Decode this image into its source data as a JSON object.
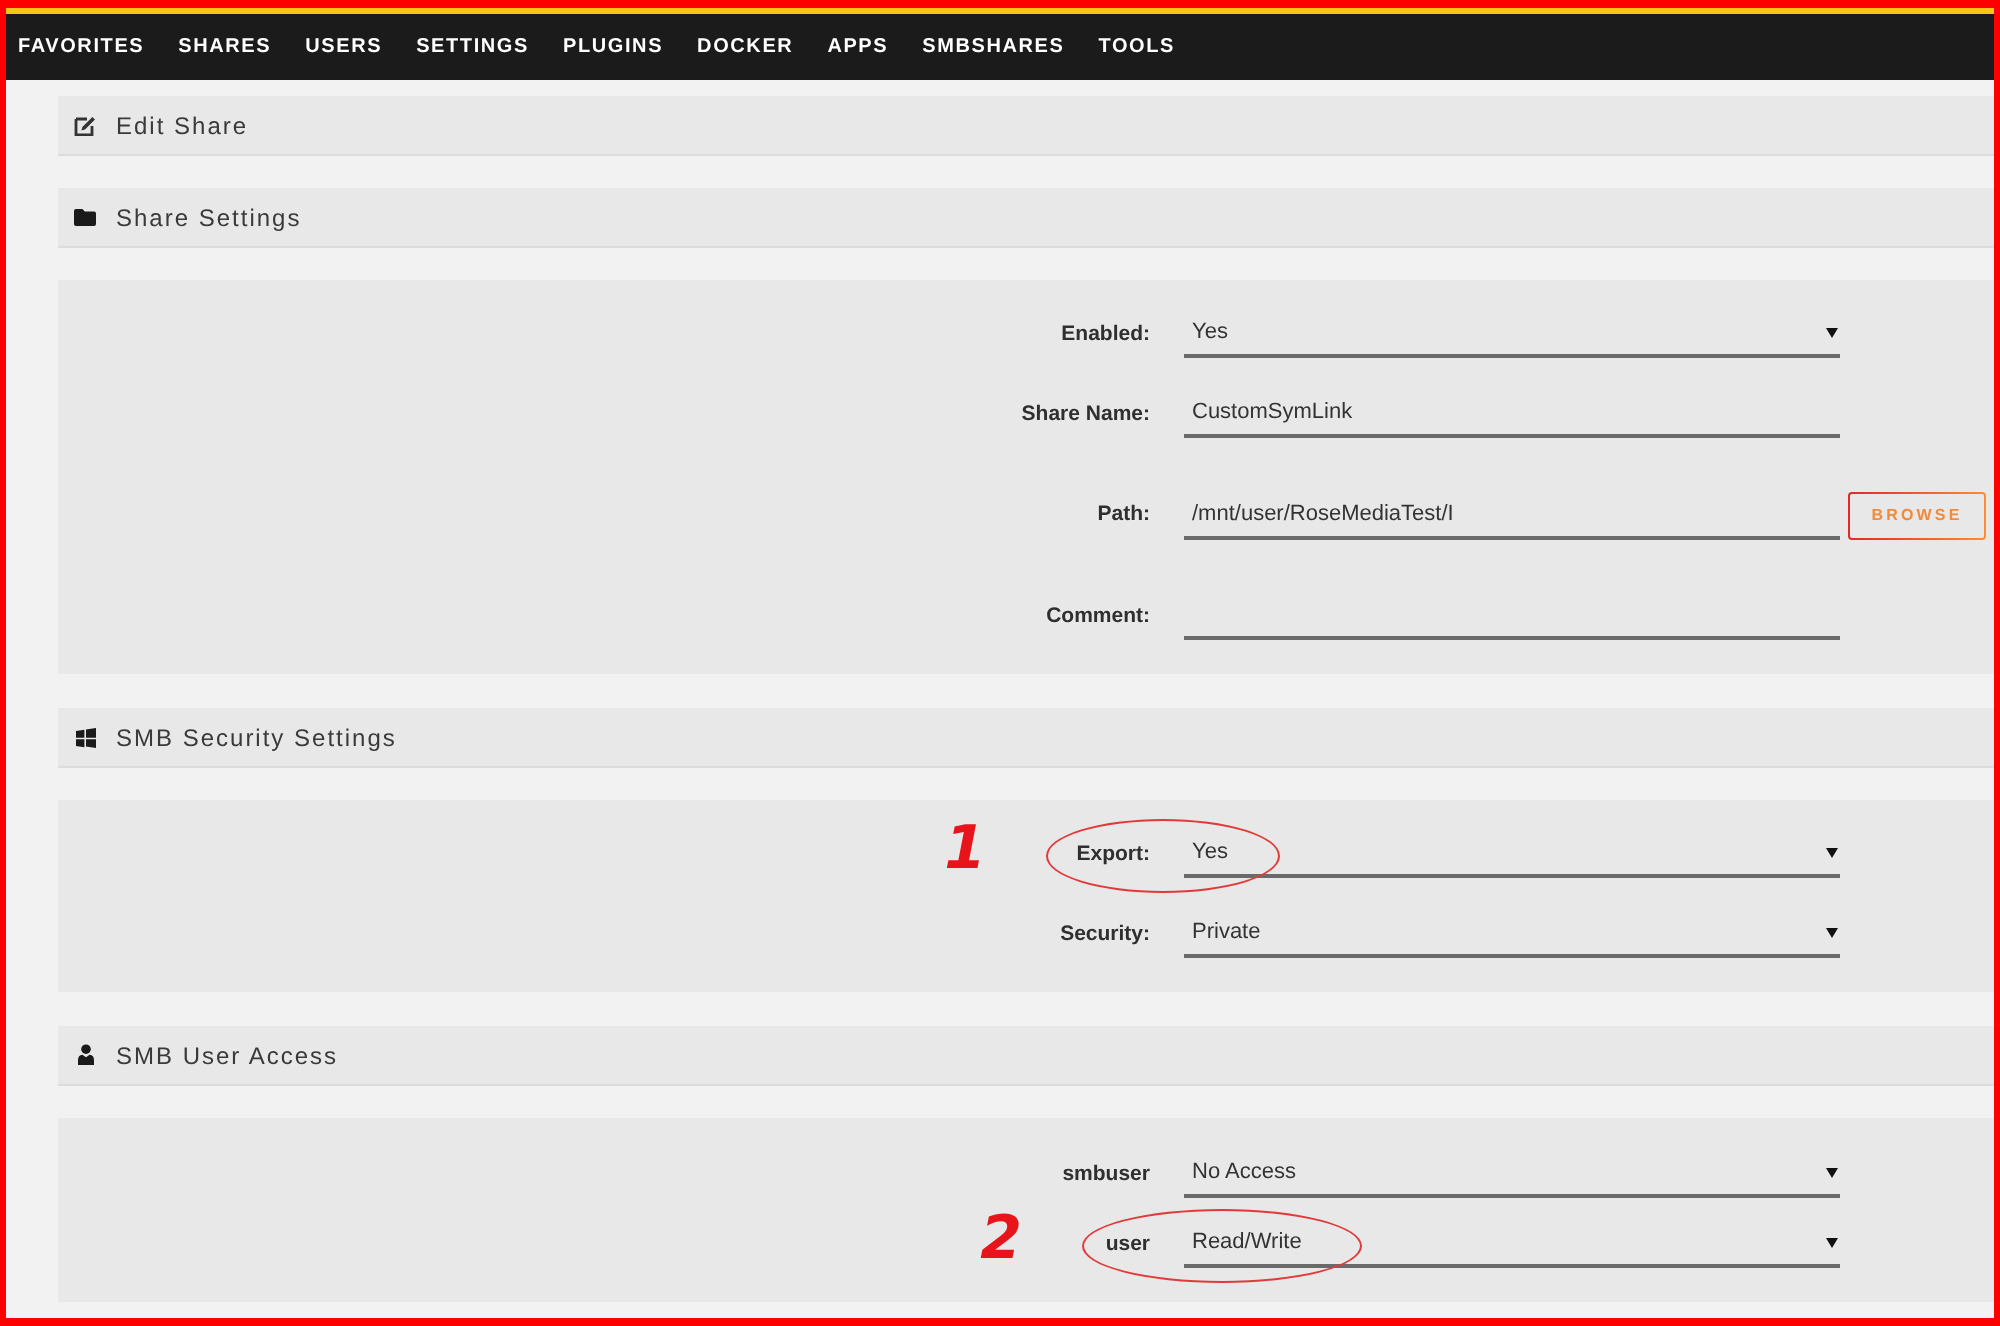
{
  "nav": {
    "items": [
      {
        "label": "FAVORITES"
      },
      {
        "label": "SHARES"
      },
      {
        "label": "USERS"
      },
      {
        "label": "SETTINGS"
      },
      {
        "label": "PLUGINS"
      },
      {
        "label": "DOCKER"
      },
      {
        "label": "APPS"
      },
      {
        "label": "SMBSHARES"
      },
      {
        "label": "TOOLS"
      }
    ]
  },
  "sections": [
    {
      "kind": "heading",
      "title": "Edit Share"
    },
    {
      "kind": "form",
      "title": "Share Settings",
      "fields": [
        {
          "label": "Enabled:",
          "kind": "select",
          "value": "Yes"
        },
        {
          "label": "Share Name:",
          "kind": "text",
          "value": "CustomSymLink"
        },
        {
          "label": "Path:",
          "kind": "text",
          "value": "/mnt/user/RoseMediaTest/I",
          "button": "BROWSE"
        },
        {
          "label": "Comment:",
          "kind": "text"
        }
      ]
    },
    {
      "kind": "form",
      "title": "SMB Security Settings",
      "fields": [
        {
          "label": "Export:",
          "kind": "select",
          "value": "Yes",
          "annotation": "1"
        },
        {
          "label": "Security:",
          "kind": "select",
          "value": "Private"
        }
      ]
    },
    {
      "kind": "access",
      "title": "SMB User Access",
      "fields": [
        {
          "label": "smbuser",
          "kind": "select",
          "value": "No Access"
        },
        {
          "label": "user",
          "kind": "select",
          "value": "Read/Write",
          "annotation": "2"
        }
      ]
    }
  ]
}
